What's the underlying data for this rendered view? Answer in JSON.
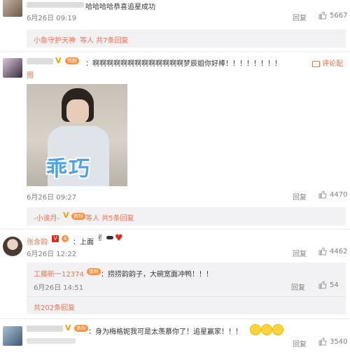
{
  "comment1": {
    "text": "哈哈哈哈恭喜追星成功",
    "time": "6月26日 09:19",
    "reply": "回复",
    "likes": "5667",
    "replies_summary": {
      "name": "小鱼守护天神",
      "rest": " 等人 共7条回复"
    }
  },
  "comment2": {
    "text": "：啊啊啊啊啊啊啊啊啊啊啊啊啊梦辰姐你好棒！！！！！！！！",
    "text_tail": "图",
    "view_pic": "评论配",
    "image_caption": "乖巧",
    "time": "6月26日 09:27",
    "reply": "回复",
    "likes": "4470",
    "replies_summary": {
      "name": "-小诶月-",
      "rest": " 等人 共5条回复"
    }
  },
  "comment3": {
    "user": "张含韵",
    "text": "：上面",
    "time": "6月26日 12:22",
    "reply": "回复",
    "likes": "4462",
    "sub": {
      "user": "工藤新一12374",
      "text": "：捞捞韵韵子，大碗宽面冲鸭！！！",
      "time": "6月26日 14:51",
      "reply": "回复",
      "likes": "54"
    },
    "total_replies": "共202条回复"
  },
  "comment4": {
    "text": "：身为梅格妮我可是太羡慕你了！追星赢家！！！",
    "reply": "回复",
    "likes": "3540"
  },
  "colors": {
    "link": "#eb7350",
    "muted": "#808080",
    "badge": "#ff8f3f"
  },
  "icons": [
    "thumb-up-icon",
    "comment-icon",
    "verified-icon",
    "fan-badge-icon"
  ]
}
